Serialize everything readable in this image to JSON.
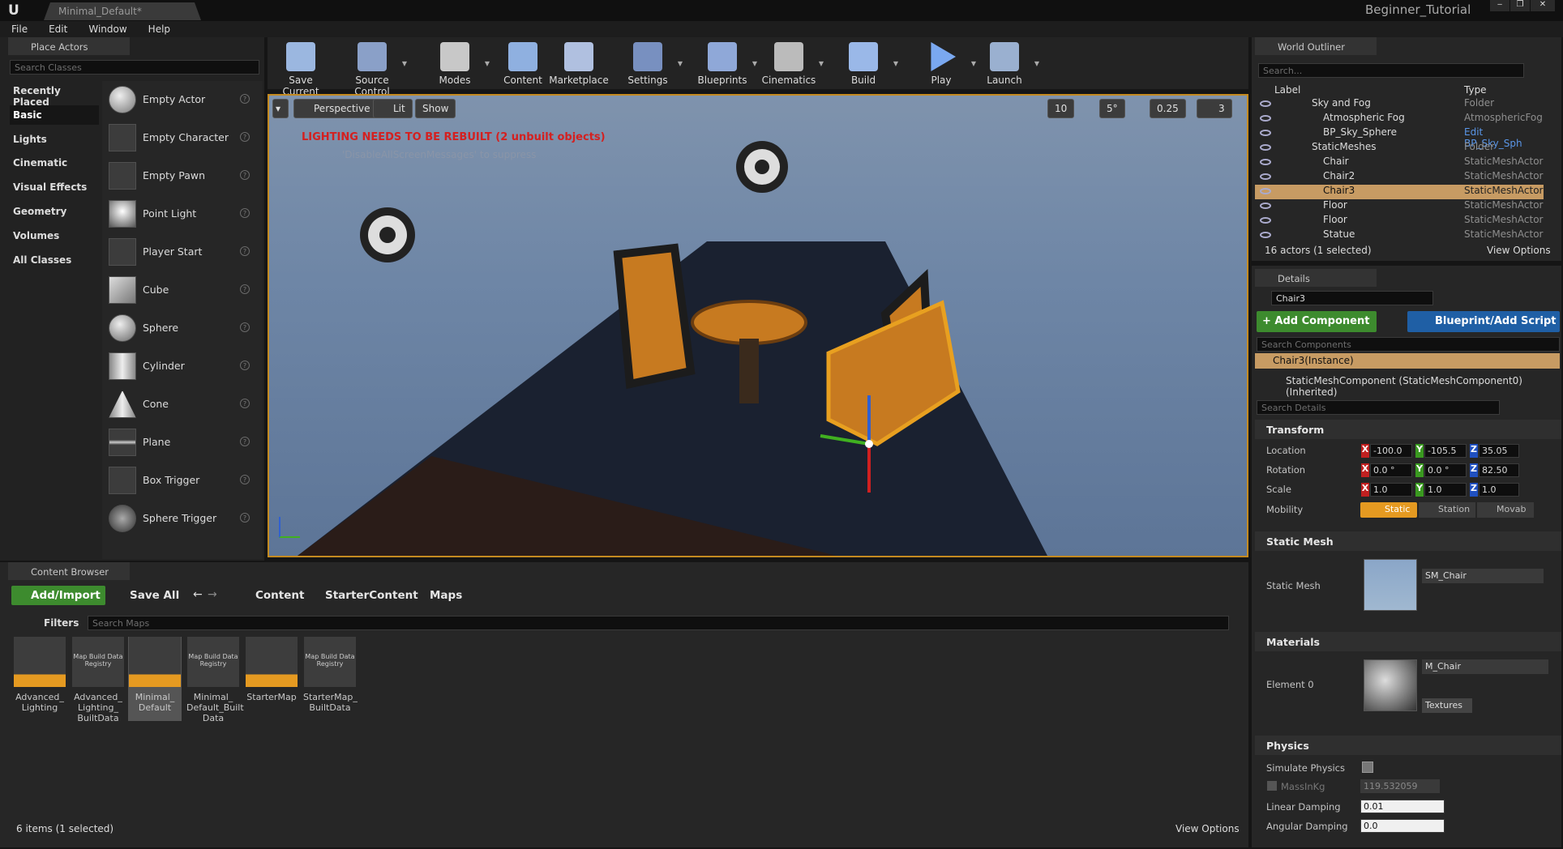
{
  "app": {
    "title": "Minimal_Default*",
    "project": "Beginner_Tutorial"
  },
  "menu": [
    "File",
    "Edit",
    "Window",
    "Help"
  ],
  "place_actors": {
    "tab": "Place Actors",
    "search_placeholder": "Search Classes",
    "categories": [
      "Recently Placed",
      "Basic",
      "Lights",
      "Cinematic",
      "Visual Effects",
      "Geometry",
      "Volumes",
      "All Classes"
    ],
    "selected_category": "Basic",
    "actors": [
      "Empty Actor",
      "Empty Character",
      "Empty Pawn",
      "Point Light",
      "Player Start",
      "Cube",
      "Sphere",
      "Cylinder",
      "Cone",
      "Plane",
      "Box Trigger",
      "Sphere Trigger"
    ]
  },
  "toolbar": [
    "Save Current",
    "Source Control",
    "Modes",
    "Content",
    "Marketplace",
    "Settings",
    "Blueprints",
    "Cinematics",
    "Build",
    "Play",
    "Launch"
  ],
  "viewport": {
    "perspective": "Perspective",
    "lit": "Lit",
    "show": "Show",
    "warning": "LIGHTING NEEDS TO BE REBUILT (2 unbuilt objects)",
    "suppress": "'DisableAllScreenMessages' to suppress",
    "grid": "10",
    "rot": "5°",
    "scale": "0.25",
    "camspeed": "3"
  },
  "outliner": {
    "tab": "World Outliner",
    "search_placeholder": "Search...",
    "col_label": "Label",
    "col_type": "Type",
    "rows": [
      {
        "label": "Sky and Fog",
        "type": "Folder"
      },
      {
        "label": "Atmospheric Fog",
        "type": "AtmosphericFog"
      },
      {
        "label": "BP_Sky_Sphere",
        "type": "Edit BP_Sky_Sph"
      },
      {
        "label": "StaticMeshes",
        "type": "Folder"
      },
      {
        "label": "Chair",
        "type": "StaticMeshActor"
      },
      {
        "label": "Chair2",
        "type": "StaticMeshActor"
      },
      {
        "label": "Chair3",
        "type": "StaticMeshActor"
      },
      {
        "label": "Floor",
        "type": "StaticMeshActor"
      },
      {
        "label": "Floor",
        "type": "StaticMeshActor"
      },
      {
        "label": "Statue",
        "type": "StaticMeshActor"
      }
    ],
    "status": "16 actors (1 selected)",
    "view_options": "View Options"
  },
  "details": {
    "tab": "Details",
    "name": "Chair3",
    "add_component": "+ Add Component",
    "blueprint": "Blueprint/Add Script",
    "search_components": "Search Components",
    "instance": "Chair3(Instance)",
    "component": "StaticMeshComponent (StaticMeshComponent0) (Inherited)",
    "search_details": "Search Details",
    "transform": "Transform",
    "location_label": "Location",
    "rotation_label": "Rotation",
    "scale_label": "Scale",
    "mobility_label": "Mobility",
    "location": [
      "-100.0",
      "-105.5",
      "35.05"
    ],
    "rotation": [
      "0.0 °",
      "0.0 °",
      "82.50"
    ],
    "scale": [
      "1.0",
      "1.0",
      "1.0"
    ],
    "mobility": [
      "Static",
      "Station",
      "Movab"
    ],
    "static_mesh_section": "Static Mesh",
    "static_mesh_label": "Static Mesh",
    "static_mesh_value": "SM_Chair",
    "materials_section": "Materials",
    "element0": "Element 0",
    "material_value": "M_Chair",
    "textures": "Textures",
    "physics_section": "Physics",
    "simulate_physics": "Simulate Physics",
    "mass_label": "MassInKg",
    "mass_value": "119.532059",
    "linear_damping": "Linear Damping",
    "linear_value": "0.01",
    "angular_damping": "Angular Damping",
    "angular_value": "0.0"
  },
  "content_browser": {
    "tab": "Content Browser",
    "add_import": "Add/Import",
    "save_all": "Save All",
    "path": [
      "Content",
      "StarterContent",
      "Maps"
    ],
    "filters": "Filters",
    "search_placeholder": "Search Maps",
    "items": [
      "Advanced_ Lighting",
      "Advanced_ Lighting_ BuiltData",
      "Minimal_ Default",
      "Minimal_ Default_Built Data",
      "StarterMap",
      "StarterMap_ BuiltData"
    ],
    "registry_label": "Map Build Data Registry",
    "status": "6 items (1 selected)",
    "view_options": "View Options"
  },
  "colors": {
    "accent": "#e59a21",
    "selected_row": "#c79b63",
    "green": "#3d8b2e",
    "blue": "#1f5fa5",
    "warning": "#d42020"
  }
}
